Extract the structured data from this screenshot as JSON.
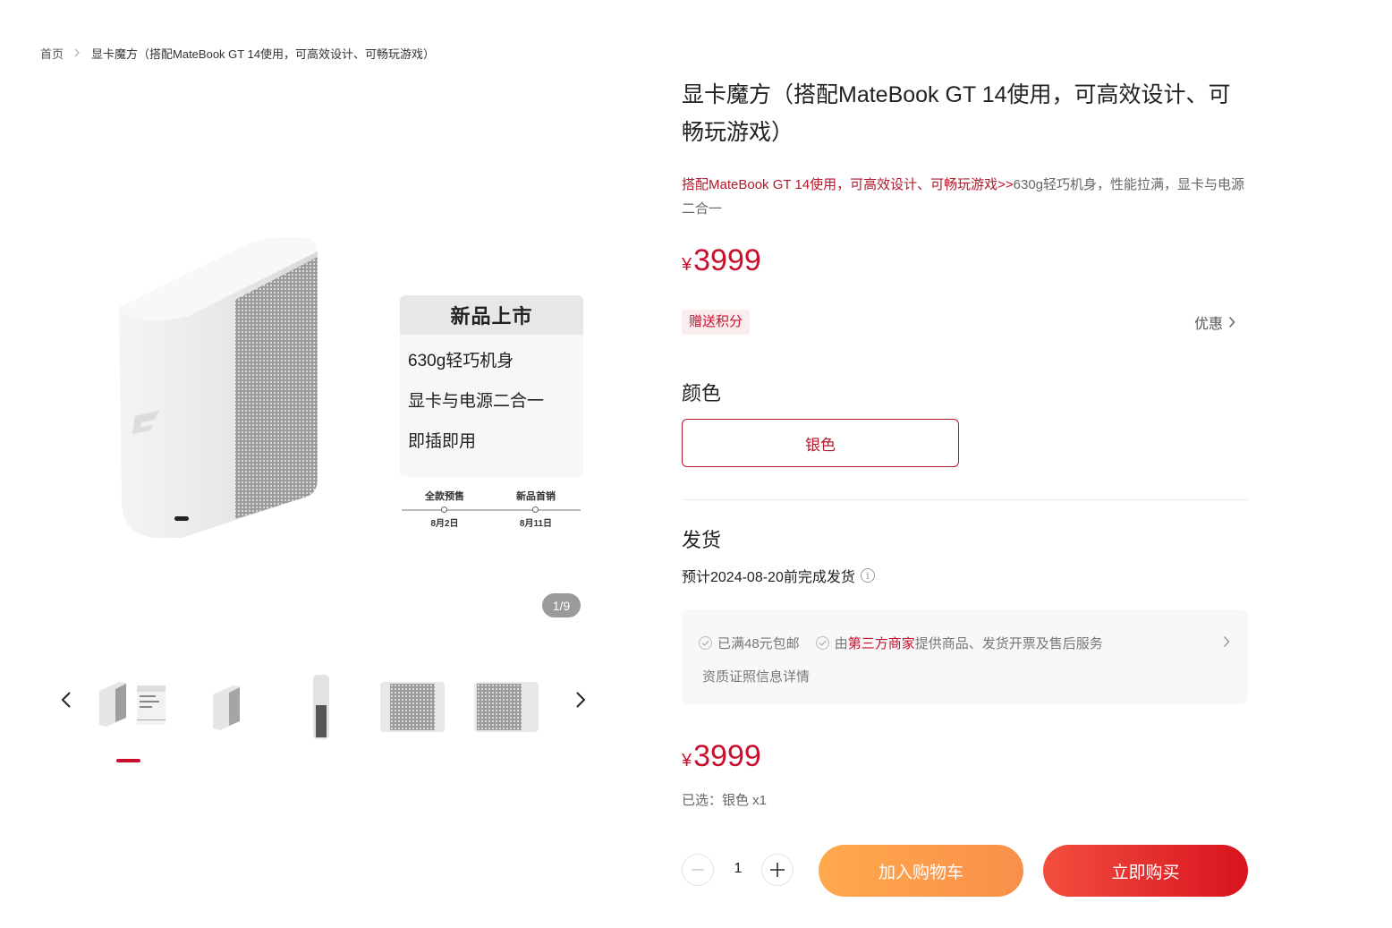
{
  "breadcrumb": {
    "home": "首页",
    "current": "显卡魔方（搭配MateBook GT 14使用，可高效设计、可畅玩游戏）"
  },
  "gallery": {
    "promo": {
      "header": "新品上市",
      "lines": [
        "630g轻巧机身",
        "显卡与电源二合一",
        "即插即用"
      ],
      "timeline": [
        {
          "label": "全款预售",
          "date": "8月2日"
        },
        {
          "label": "新品首销",
          "date": "8月11日"
        }
      ]
    },
    "counter": "1/9",
    "thumbnail_count": 5,
    "active_thumbnail": 1
  },
  "product": {
    "title": "显卡魔方（搭配MateBook GT 14使用，可高效设计、可畅玩游戏）",
    "subtitle_highlight": "搭配MateBook GT 14使用，可高效设计、可畅玩游戏>>",
    "subtitle_rest": "630g轻巧机身，性能拉满，显卡与电源二合一",
    "currency": "¥",
    "price": "3999",
    "gift_badge": "赠送积分",
    "discount_label": "优惠",
    "color_section": "颜色",
    "color_option": "银色",
    "shipping_section": "发货",
    "shipping_text": "预计2024-08-20前完成发货",
    "services": {
      "free_shipping": "已满48元包邮",
      "provider_prefix": "由",
      "provider_highlight": "第三方商家",
      "provider_suffix": "提供商品、发货开票及售后服务",
      "qualification_link": "资质证照信息详情"
    },
    "selected_summary": "已选：银色 x1",
    "quantity": "1",
    "add_to_cart": "加入购物车",
    "buy_now": "立即购买"
  },
  "colors": {
    "accent": "#c8102e",
    "cart_button": "#f99a4b",
    "buy_button": "#e22b2b"
  }
}
